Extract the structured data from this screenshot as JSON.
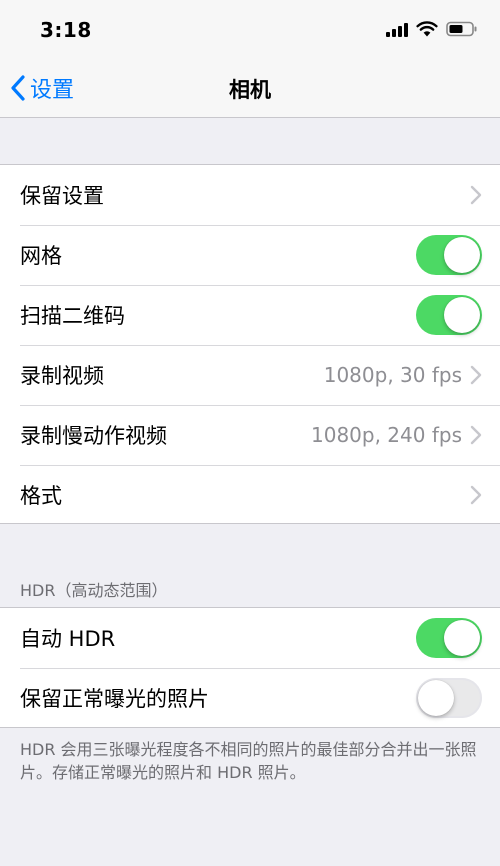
{
  "status_bar": {
    "time": "3:18",
    "icons": [
      "cellular-signal-icon",
      "wifi-icon",
      "battery-icon"
    ]
  },
  "nav": {
    "back_label": "设置",
    "title": "相机",
    "accent_color": "#007aff"
  },
  "group1": {
    "rows": [
      {
        "label": "保留设置",
        "value": "",
        "control": "chevron"
      },
      {
        "label": "网格",
        "control": "toggle",
        "on": true
      },
      {
        "label": "扫描二维码",
        "control": "toggle",
        "on": true
      },
      {
        "label": "录制视频",
        "value": "1080p, 30 fps",
        "control": "chevron"
      },
      {
        "label": "录制慢动作视频",
        "value": "1080p, 240 fps",
        "control": "chevron"
      },
      {
        "label": "格式",
        "value": "",
        "control": "chevron"
      }
    ]
  },
  "hdr_section": {
    "header": "HDR（高动态范围）",
    "rows": [
      {
        "label": "自动 HDR",
        "control": "toggle",
        "on": true
      },
      {
        "label": "保留正常曝光的照片",
        "control": "toggle",
        "on": false
      }
    ],
    "footer": "HDR 会用三张曝光程度各不相同的照片的最佳部分合并出一张照片。存储正常曝光的照片和 HDR 照片。"
  },
  "colors": {
    "toggle_on": "#4cd964",
    "toggle_off": "#e9e9ea",
    "background": "#efeff4",
    "secondary_text": "#8e8e93"
  }
}
